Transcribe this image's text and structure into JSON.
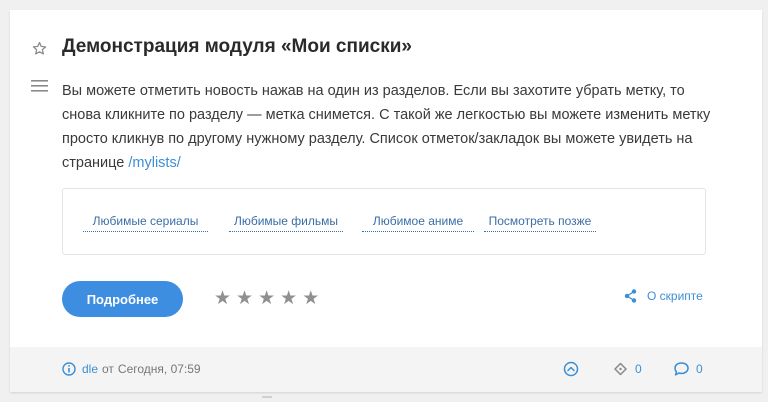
{
  "article": {
    "title": "Демонстрация модуля «Мои списки»",
    "description": "Вы можете отметить новость нажав на один из разделов. Если вы захотите убрать метку, то снова кликните по разделу — метка снимется. С такой же легкостью вы можете изменить метку просто кликнув по другому нужному разделу. Список отметок/закладок вы можете увидеть на странице ",
    "link_text": "/mylists/"
  },
  "lists": [
    {
      "label": "Любимые сериалы"
    },
    {
      "label": "Любимые фильмы"
    },
    {
      "label": "Любимое аниме"
    },
    {
      "label": "Посмотреть позже"
    }
  ],
  "actions": {
    "more_button": "Подробнее",
    "rating_stars": 5,
    "rating_value": 0,
    "share_label": "О скрипте"
  },
  "footer": {
    "author": "dle",
    "date_prefix": "от",
    "date": "Сегодня, 07:59",
    "reposts": "0",
    "comments": "0"
  },
  "colors": {
    "accent": "#3d8ee0",
    "link": "#3b8fd6",
    "star": "#909090"
  },
  "icons": {
    "favorite": "star-outline-icon",
    "menu": "hamburger-menu-icon",
    "share": "share-icon",
    "author": "info-icon",
    "rating_up": "chevron-up-circle-icon",
    "repost": "repost-icon",
    "comments": "speech-bubble-icon"
  }
}
